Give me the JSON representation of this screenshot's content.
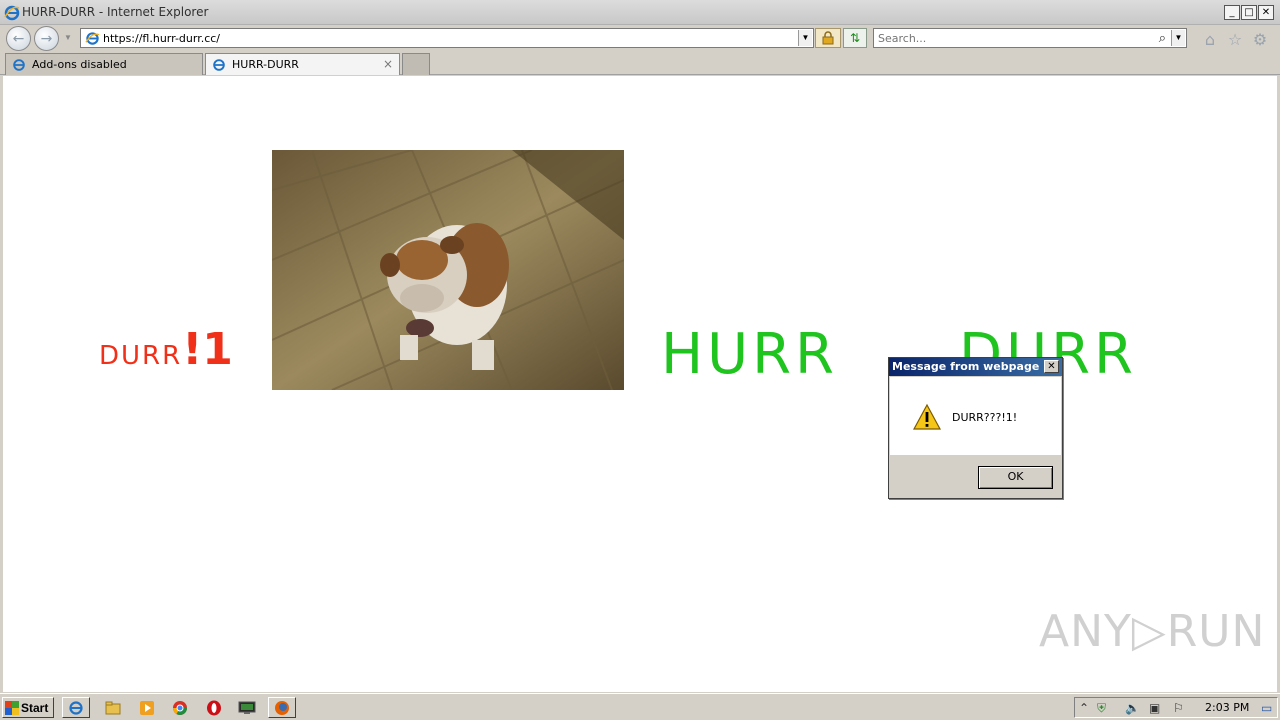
{
  "window": {
    "title": "HURR-DURR - Internet Explorer",
    "minimize": "_",
    "maximize": "□",
    "close": "✕"
  },
  "navbar": {
    "url": "https://fl.hurr-durr.cc/",
    "search_placeholder": "Search..."
  },
  "tabs": [
    {
      "label": "Add-ons disabled"
    },
    {
      "label": "HURR-DURR",
      "close": "×"
    }
  ],
  "page": {
    "left_small": "DURR",
    "left_big": "!1",
    "hurr": "HURR",
    "durr": "DURR",
    "watermark": "ANY▷RUN"
  },
  "dialog": {
    "title": "Message from webpage",
    "message": "DURR???!1!",
    "ok_label": "OK",
    "close": "✕"
  },
  "taskbar": {
    "start_label": "Start",
    "clock": "2:03 PM"
  },
  "colors": {
    "left_text": "#f03018",
    "hurr_durr": "#1fc41f"
  }
}
